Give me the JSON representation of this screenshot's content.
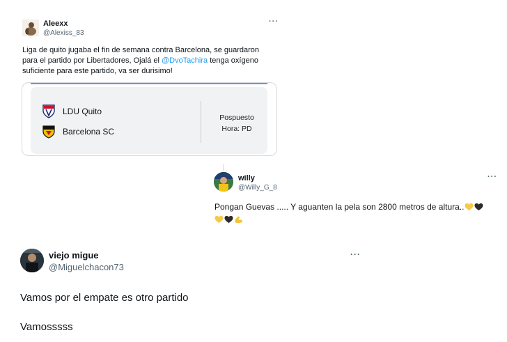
{
  "tweets": [
    {
      "name": "Aleexx",
      "handle": "@Alexiss_83",
      "more_label": "···",
      "text_line1": "Liga de quito jugaba el fin de semana contra Barcelona, se guardaron",
      "text_line2_pre": "para el partido por Libertadores, Ojalá el ",
      "text_mention": "@DvoTachira",
      "text_line2_post": " tenga oxígeno",
      "text_line3": "suficiente para este partido, va ser durisimo!",
      "card": {
        "home_team": "LDU Quito",
        "away_team": "Barcelona SC",
        "status": "Pospuesto",
        "time": "Hora: PD",
        "home_crest_icon": "ldu-quito-crest-icon",
        "away_crest_icon": "barcelona-sc-crest-icon"
      }
    },
    {
      "name": "willy",
      "handle": "@Willy_G_8",
      "more_label": "···",
      "text_line1": "Pongan Guevas ..... Y aguanten la pela son 2800 metros de altura.."
    },
    {
      "name": "viejo migue",
      "handle": "@Miguelchacon73",
      "more_label": "···",
      "text_line1": "Vamos por el empate es otro partido",
      "text_line2": "Vamosssss"
    }
  ],
  "colors": {
    "mention": "#1d9bf0",
    "secondary_text": "#536471",
    "yellow_heart": "#f7c948",
    "black_heart": "#2b2b2b",
    "muscle": "#f5c33b"
  }
}
